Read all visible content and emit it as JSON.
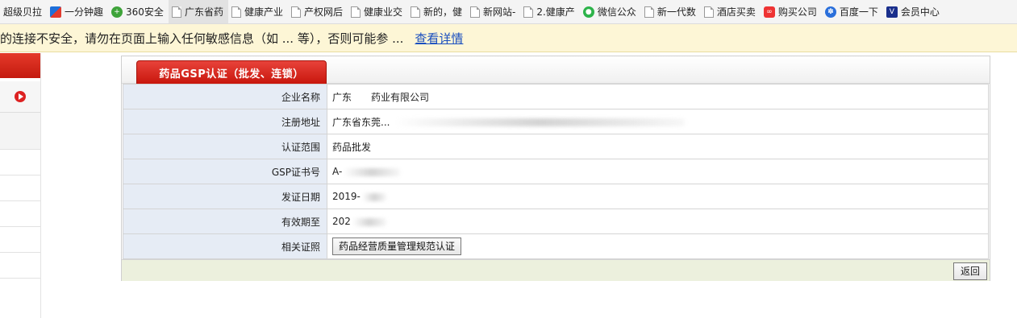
{
  "bookmarks": [
    {
      "label": "超级贝拉",
      "icon": "page-icon"
    },
    {
      "label": "一分钟趣",
      "icon": "colored-triangle-icon"
    },
    {
      "label": "360安全",
      "icon": "360-icon"
    },
    {
      "label": "广东省药",
      "icon": "document-icon"
    },
    {
      "label": "健康产业",
      "icon": "document-icon"
    },
    {
      "label": "产权网后",
      "icon": "document-icon"
    },
    {
      "label": "健康业交",
      "icon": "document-icon"
    },
    {
      "label": "新的，健",
      "icon": "document-icon"
    },
    {
      "label": "新网站-",
      "icon": "document-icon"
    },
    {
      "label": "2.健康产",
      "icon": "document-icon"
    },
    {
      "label": "微信公众",
      "icon": "wechat-icon"
    },
    {
      "label": "新一代数",
      "icon": "document-icon"
    },
    {
      "label": "酒店买卖",
      "icon": "document-icon"
    },
    {
      "label": "购买公司",
      "icon": "shop-icon"
    },
    {
      "label": "百度一下",
      "icon": "baidu-paw-icon"
    },
    {
      "label": "会员中心",
      "icon": "vip-icon"
    }
  ],
  "warning": {
    "text": "的连接不安全，请勿在页面上输入任何敏感信息（如 ... 等），否则可能参 ... ",
    "link": "查看详情"
  },
  "panel": {
    "tab_title": "药品GSP认证（批发、连锁）",
    "rows": [
      {
        "label": "企业名称",
        "value": "广东　　药业有限公司"
      },
      {
        "label": "注册地址",
        "value": "广东省东莞..."
      },
      {
        "label": "认证范围",
        "value": "药品批发"
      },
      {
        "label": "GSP证书号",
        "value": "A-"
      },
      {
        "label": "发证日期",
        "value": "2019-"
      },
      {
        "label": "有效期至",
        "value": "202"
      },
      {
        "label": "相关证照",
        "button": "药品经营质量管理规范认证"
      }
    ],
    "back_button": "返回"
  }
}
